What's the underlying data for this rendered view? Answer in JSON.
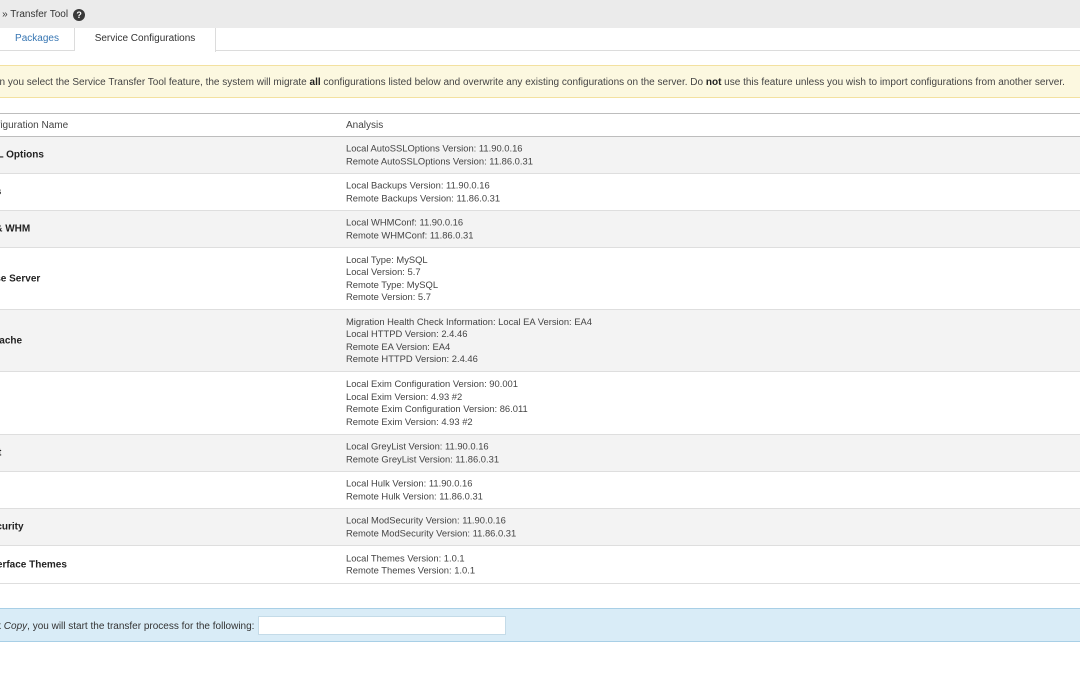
{
  "breadcrumb": {
    "text": "rs » Transfer Tool",
    "help_icon": "question-circle-icon"
  },
  "tabs": [
    {
      "label": "Packages"
    },
    {
      "label": "Service Configurations"
    }
  ],
  "notice": {
    "part1": "en you select the Service Transfer Tool feature, the system will migrate ",
    "bold1": "all",
    "part2": " configurations listed below and overwrite any existing configurations on the server. Do ",
    "bold2": "not",
    "part3": " use this feature unless you wish to import configurations from another server."
  },
  "table": {
    "headers": {
      "name": "nfiguration Name",
      "analysis": "Analysis"
    },
    "rows": [
      {
        "name": "oSSL Options",
        "lines": [
          "Local AutoSSLOptions Version: 11.90.0.16",
          "Remote AutoSSLOptions Version: 11.86.0.31"
        ]
      },
      {
        "name": "kups",
        "lines": [
          "Local Backups Version: 11.90.0.16",
          "Remote Backups Version: 11.86.0.31"
        ]
      },
      {
        "name": "nel & WHM",
        "lines": [
          "Local WHMConf: 11.90.0.16",
          "Remote WHMConf: 11.86.0.31"
        ]
      },
      {
        "name": "abase Server",
        "lines": [
          "Local Type: MySQL",
          "Local Version: 5.7",
          "Remote Type: MySQL",
          "Remote Version: 5.7"
        ]
      },
      {
        "name": "y Apache",
        "lines": [
          "Migration Health Check Information: Local EA Version: EA4",
          "Local HTTPD Version: 2.4.46",
          "Remote EA Version: EA4",
          "Remote HTTPD Version: 2.4.46"
        ]
      },
      {
        "name": "n",
        "lines": [
          "Local Exim Configuration Version: 90.001",
          "Local Exim Version: 4.93 #2",
          "Remote Exim Configuration Version: 86.011",
          "Remote Exim Version: 4.93 #2"
        ]
      },
      {
        "name": "yList",
        "lines": [
          "Local GreyList Version: 11.90.0.16",
          "Remote GreyList Version: 11.86.0.31"
        ]
      },
      {
        "name": "k",
        "lines": [
          "Local Hulk Version: 11.90.0.16",
          "Remote Hulk Version: 11.86.0.31"
        ]
      },
      {
        "name": "dSecurity",
        "lines": [
          "Local ModSecurity Version: 11.90.0.16",
          "Remote ModSecurity Version: 11.86.0.31"
        ]
      },
      {
        "name": "r Interface Themes",
        "lines": [
          "Local Themes Version: 1.0.1",
          "Remote Themes Version: 1.0.1"
        ]
      }
    ]
  },
  "footer": {
    "prefix": "k ",
    "copy_word": "Copy",
    "suffix": ", you will start the transfer process for the following:",
    "input_value": ""
  }
}
